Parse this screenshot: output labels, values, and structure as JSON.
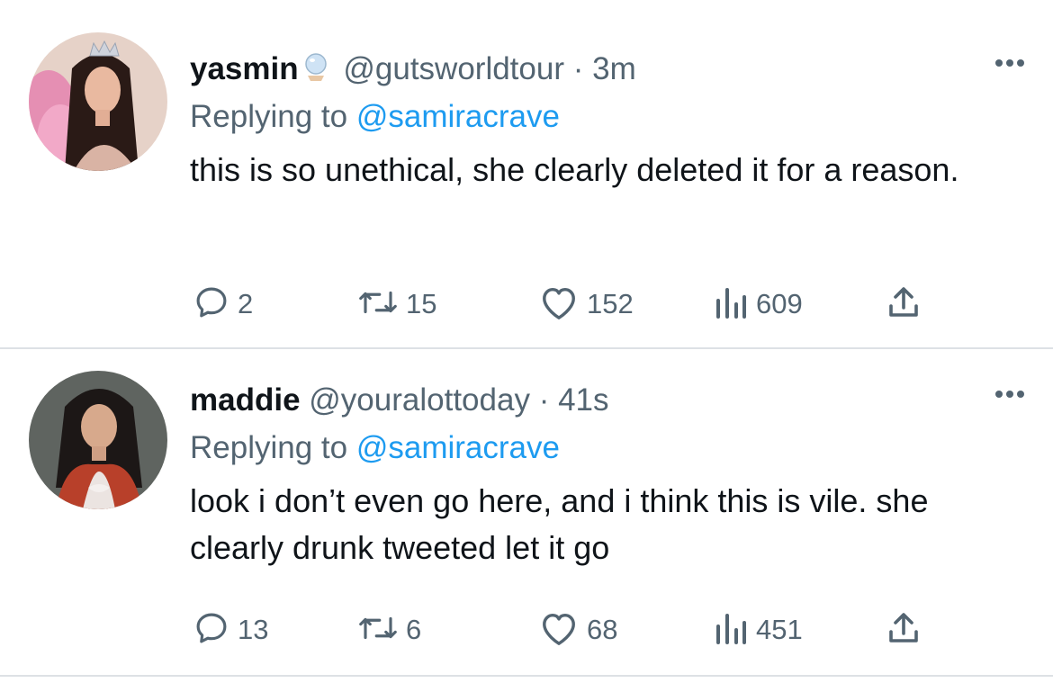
{
  "tweets": [
    {
      "name": "yasmin",
      "handle": "@gutsworldtour",
      "separator": "·",
      "time": "3m",
      "reply_prefix": "Replying to",
      "reply_to": "@samiracrave",
      "text": "this is so unethical, she clearly deleted it for a reason.",
      "replies": "2",
      "retweets": "15",
      "likes": "152",
      "views": "609"
    },
    {
      "name": "maddie",
      "handle": "@youralottoday",
      "separator": "·",
      "time": "41s",
      "reply_prefix": "Replying to",
      "reply_to": "@samiracrave",
      "text": "look i don’t even go here, and i think this is vile. she clearly drunk tweeted let it go",
      "replies": "13",
      "retweets": "6",
      "likes": "68",
      "views": "451"
    }
  ],
  "icons": {
    "more": "more-horizontal-icon",
    "reply": "speech-bubble-icon",
    "retweet": "retweet-arrows-icon",
    "like": "heart-outline-icon",
    "views": "bar-chart-icon",
    "share": "share-upload-icon",
    "badge": "crystal-ball-emoji"
  },
  "colors": {
    "text": "#0f1419",
    "secondary": "#536471",
    "link": "#1d9bf0",
    "divider": "#dde1e5"
  }
}
